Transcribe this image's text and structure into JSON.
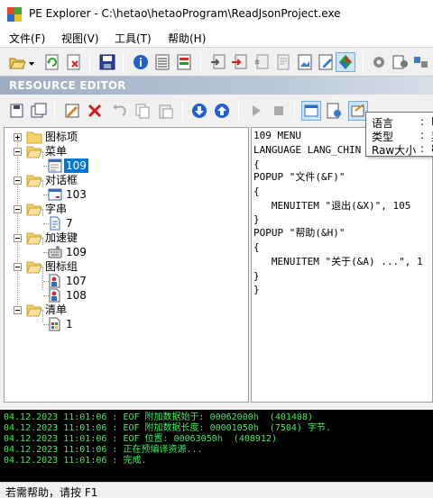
{
  "window": {
    "title": "PE Explorer - C:\\hetao\\hetaoProgram\\ReadJsonProject.exe"
  },
  "menu": [
    "文件(F)",
    "视图(V)",
    "工具(T)",
    "帮助(H)"
  ],
  "panel_header": "RESOURCE EDITOR",
  "tree": [
    {
      "label": "图标项",
      "expanded": false
    },
    {
      "label": "菜单",
      "expanded": true,
      "children": [
        {
          "label": "109",
          "selected": true
        }
      ]
    },
    {
      "label": "对话框",
      "expanded": true,
      "children": [
        {
          "label": "103"
        }
      ]
    },
    {
      "label": "字串",
      "expanded": true,
      "children": [
        {
          "label": "7"
        }
      ]
    },
    {
      "label": "加速键",
      "expanded": true,
      "children": [
        {
          "label": "109"
        }
      ]
    },
    {
      "label": "图标组",
      "expanded": true,
      "children": [
        {
          "label": "107"
        },
        {
          "label": "108"
        }
      ]
    },
    {
      "label": "清单",
      "expanded": true,
      "children": [
        {
          "label": "1"
        }
      ]
    }
  ],
  "code": [
    "109 MENU",
    "LANGUAGE LANG_CHIN",
    "{",
    "POPUP \"文件(&F)\"",
    "{",
    "   MENUITEM \"退出(&X)\", 105",
    "}",
    "POPUP \"帮助(&H)\"",
    "{",
    "   MENUITEM \"关于(&A) ...\", 1",
    "}",
    "}"
  ],
  "tooltip": {
    "rows": [
      {
        "key": "语言",
        "value": "L"
      },
      {
        "key": "类型",
        "value": "菜"
      },
      {
        "key": "Raw大小",
        "value": "8"
      }
    ]
  },
  "log": [
    "04.12.2023 11:01:06 : EOF 附加数据始于: 00062000h  (401408)",
    "04.12.2023 11:01:06 : EOF 附加数据长度: 00001050h  (7504) 字节.",
    "04.12.2023 11:01:06 : EOF 位置: 00063050h  (408912)",
    "04.12.2023 11:01:06 : 正在预编译资源...",
    "04.12.2023 11:01:06 : 完成."
  ],
  "status": "若需帮助，请按 F1",
  "colors": {
    "selection": "#0078d7",
    "log_text": "#3cf05a",
    "log_bg": "#000000",
    "header_text": "#ffffff"
  }
}
